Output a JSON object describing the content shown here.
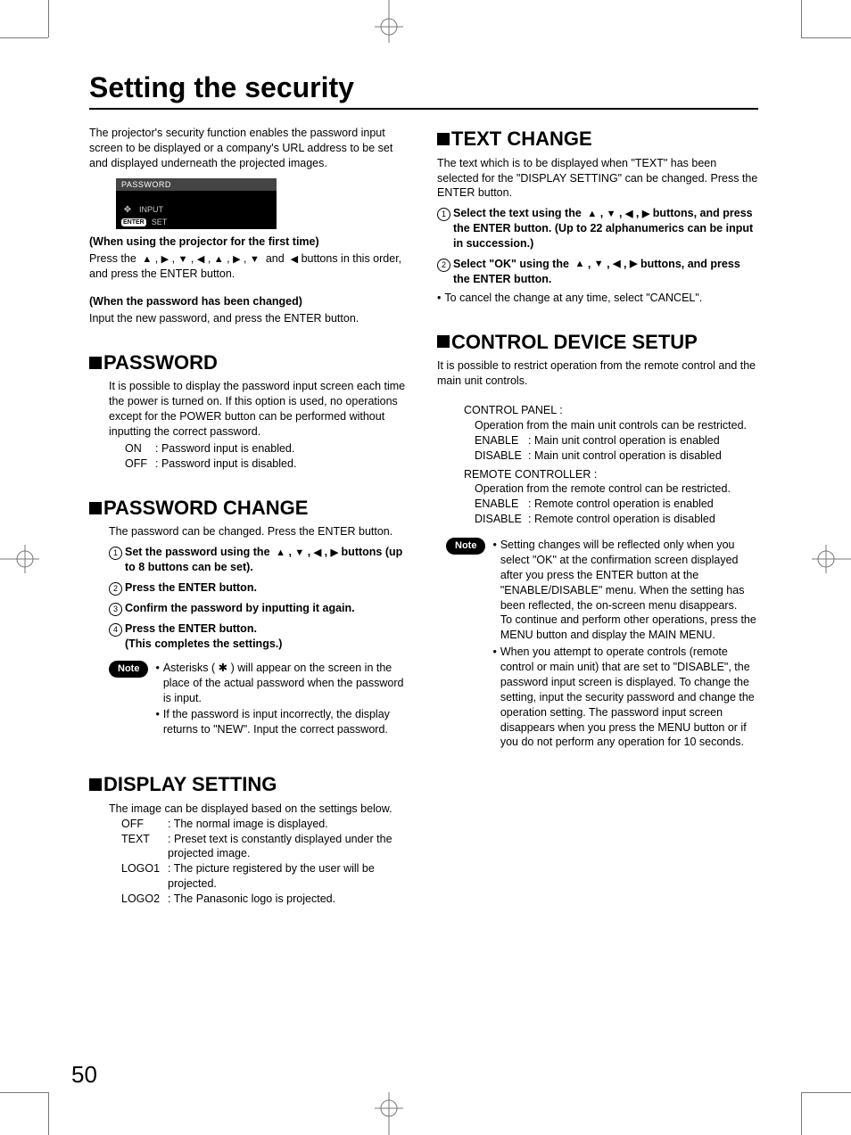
{
  "page_number": "50",
  "title": "Setting the security",
  "intro": "The projector's security function enables the password input screen to be displayed or a company's URL address to be set and displayed underneath the projected images.",
  "osd": {
    "title": "PASSWORD",
    "input_label": "INPUT",
    "set_label": "SET",
    "enter_label": "ENTER"
  },
  "first_time": {
    "heading": "(When using the projector for the first time)",
    "press_prefix": "Press the",
    "press_mid": "and",
    "press_suffix": "buttons in this order, and press the ENTER button."
  },
  "changed": {
    "heading": "(When the password has been changed)",
    "body": "Input the new password, and press the ENTER button."
  },
  "sections": {
    "password": {
      "title": "PASSWORD",
      "body": "It is possible to display the password input screen each time the power is turned on. If this option is used, no operations except for the POWER button can be performed without inputting the correct password.",
      "on_key": "ON",
      "on_val": ": Password input is enabled.",
      "off_key": "OFF",
      "off_val": ": Password input is disabled."
    },
    "password_change": {
      "title": "PASSWORD CHANGE",
      "body": "The password can be changed. Press the ENTER button.",
      "step1a": "Set the password using the",
      "step1b": "buttons (up to 8 buttons can be set).",
      "step2": "Press the ENTER button.",
      "step3": "Confirm the password by inputting it again.",
      "step4a": "Press the ENTER button.",
      "step4b": "(This completes the settings.)",
      "note_label": "Note",
      "note1": "Asterisks ( ✱ ) will appear on the screen in the place of the actual password when the password is input.",
      "note2": "If the password is input incorrectly, the display returns to \"NEW\". Input the correct password."
    },
    "display_setting": {
      "title": "DISPLAY SETTING",
      "body": "The image can be displayed based on the settings below.",
      "off_key": "OFF",
      "off_val": ": The normal image is displayed.",
      "text_key": "TEXT",
      "text_val": ": Preset text is constantly displayed under the projected image.",
      "logo1_key": "LOGO1",
      "logo1_val": ": The picture registered by the user will be projected.",
      "logo2_key": "LOGO2",
      "logo2_val": ": The Panasonic logo is projected."
    },
    "text_change": {
      "title": "TEXT CHANGE",
      "body": "The text which is to be displayed when \"TEXT\" has been selected for the \"DISPLAY SETTING\" can be changed. Press the ENTER button.",
      "step1a": "Select the text using the",
      "step1b": "buttons, and press the ENTER button. (Up to 22 alphanumerics can be input in succession.)",
      "step2a": "Select \"OK\" using the",
      "step2b": "buttons, and press the ENTER button.",
      "cancel": "To cancel the change at any time, select \"CANCEL\"."
    },
    "control": {
      "title": "CONTROL DEVICE SETUP",
      "body": "It is possible to restrict operation from the remote control and the main unit controls.",
      "panel_label": "CONTROL PANEL :",
      "panel_desc": "Operation from the main unit controls can be restricted.",
      "enable_key": "ENABLE",
      "panel_enable": ": Main unit control operation is enabled",
      "disable_key": "DISABLE",
      "panel_disable": ": Main unit control operation is disabled",
      "remote_label": "REMOTE CONTROLLER :",
      "remote_desc": "Operation from the remote control can be restricted.",
      "remote_enable": ": Remote control operation is enabled",
      "remote_disable": ": Remote control operation is disabled",
      "note_label": "Note",
      "note1a": "Setting changes will be reflected only when you select \"OK\" at the confirmation screen displayed after you press the ENTER button at the \"ENABLE/DISABLE\" menu. When the setting has been reflected, the on-screen menu disappears.",
      "note1b": "To continue and perform other operations, press the MENU button and display the MAIN MENU.",
      "note2": "When you attempt to operate controls (remote control or main unit) that are set to \"DISABLE\", the password input screen is displayed. To change the setting, input the security password and change the operation setting. The password input screen disappears when you press the MENU button or if you do not perform any operation for 10 seconds."
    }
  }
}
